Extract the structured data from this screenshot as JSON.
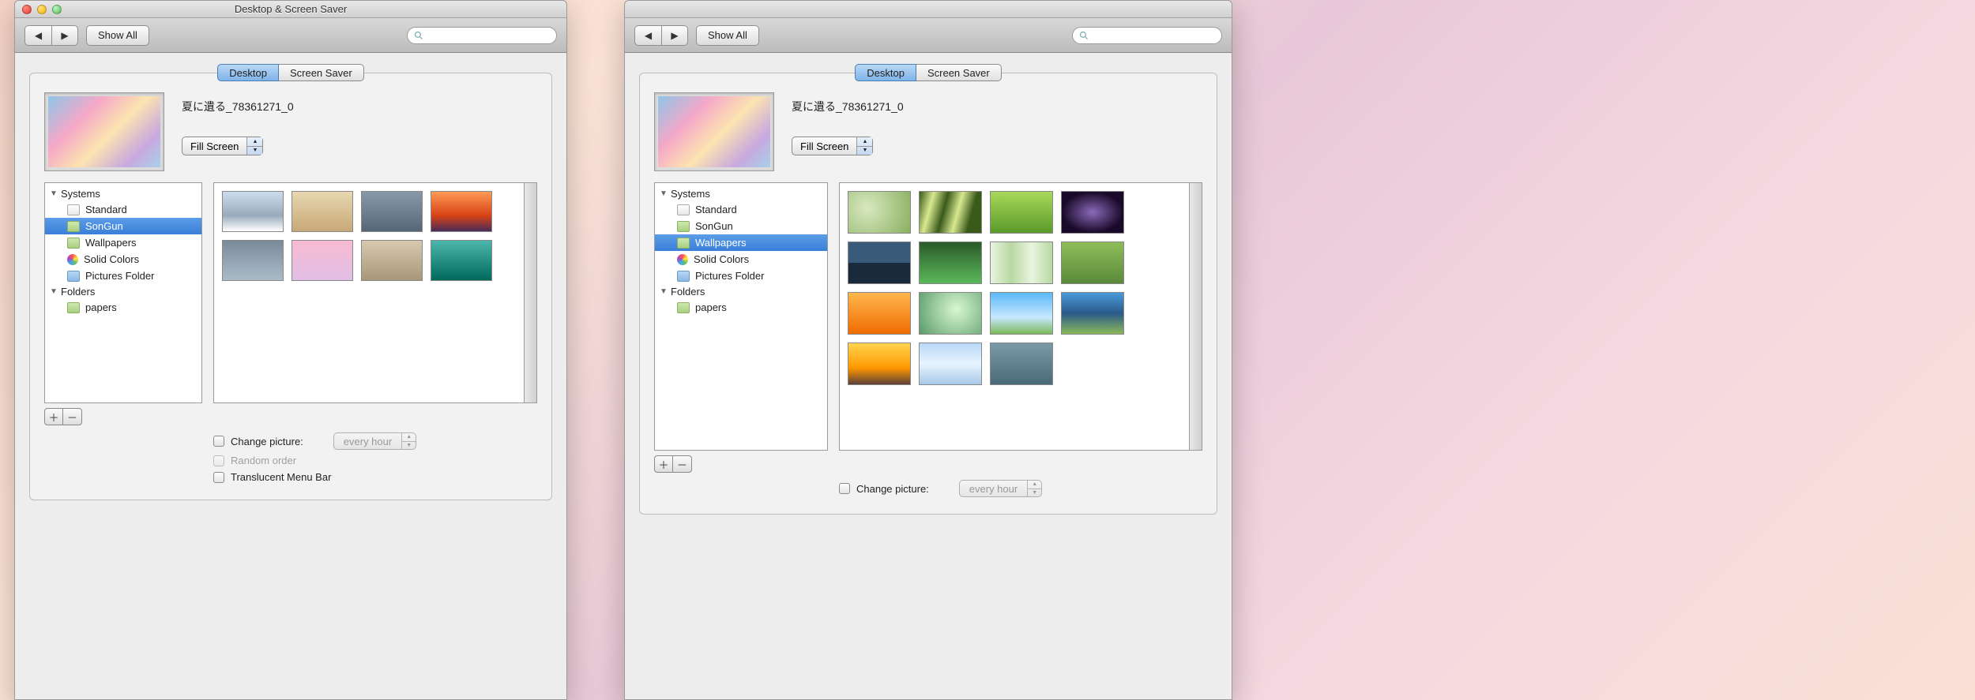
{
  "left": {
    "window_title": "Desktop & Screen Saver",
    "toolbar": {
      "show_all": "Show All"
    },
    "tabs": {
      "desktop": "Desktop",
      "screensaver": "Screen Saver",
      "active": "desktop"
    },
    "wallpaper_name": "夏に遺る_78361271_0",
    "fill_mode": "Fill Screen",
    "sidebar": {
      "group_systems": "Systems",
      "items_systems": [
        "Standard",
        "SonGun",
        "Wallpapers",
        "Solid Colors",
        "Pictures Folder"
      ],
      "group_folders": "Folders",
      "items_folders": [
        "papers"
      ],
      "selected": "SonGun"
    },
    "options": {
      "change_picture": "Change picture:",
      "interval": "every hour",
      "random_order": "Random order",
      "translucent": "Translucent Menu Bar"
    }
  },
  "right": {
    "window_title": "",
    "toolbar": {
      "show_all": "Show All"
    },
    "tabs": {
      "desktop": "Desktop",
      "screensaver": "Screen Saver",
      "active": "desktop"
    },
    "wallpaper_name": "夏に遺る_78361271_0",
    "fill_mode": "Fill Screen",
    "sidebar": {
      "group_systems": "Systems",
      "items_systems": [
        "Standard",
        "SonGun",
        "Wallpapers",
        "Solid Colors",
        "Pictures Folder"
      ],
      "group_folders": "Folders",
      "items_folders": [
        "papers"
      ],
      "selected": "Wallpapers"
    },
    "options": {
      "change_picture": "Change picture:",
      "interval": "every hour"
    }
  }
}
